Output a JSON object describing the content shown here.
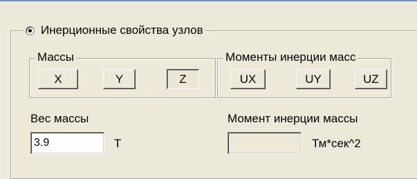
{
  "group": {
    "title": "Инерционные свойства узлов",
    "radio_selected": true
  },
  "masses": {
    "title": "Массы",
    "buttons": [
      {
        "label": "X",
        "pressed": false
      },
      {
        "label": "Y",
        "pressed": false
      },
      {
        "label": "Z",
        "pressed": true
      }
    ]
  },
  "moments": {
    "title": "Моменты инерции масс",
    "buttons": [
      {
        "label": "UX",
        "pressed": false
      },
      {
        "label": "UY",
        "pressed": false
      },
      {
        "label": "UZ",
        "pressed": false
      }
    ]
  },
  "weight": {
    "label": "Вес массы",
    "value": "3.9",
    "unit": "Т"
  },
  "inertia": {
    "label": "Момент инерции массы",
    "value": "",
    "unit": "Тм*сек^2",
    "enabled": false
  }
}
